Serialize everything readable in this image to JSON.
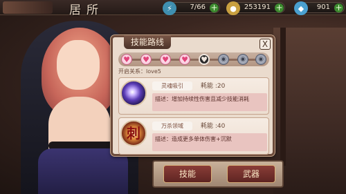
{
  "header": {
    "title": "居所",
    "resources": [
      {
        "icon": "lightning-icon",
        "value": "7/66",
        "color": "#3f8fb0"
      },
      {
        "icon": "coin-icon",
        "value": "253191",
        "color": "#c9a040"
      },
      {
        "icon": "gem-icon",
        "value": "901",
        "color": "#4aa0d0"
      }
    ]
  },
  "panel": {
    "title": "技能路线",
    "close_label": "X",
    "track": {
      "nodes": [
        {
          "state": "unlocked",
          "glyph": "♥"
        },
        {
          "state": "unlocked",
          "glyph": "♥"
        },
        {
          "state": "unlocked",
          "glyph": "♥"
        },
        {
          "state": "unlocked",
          "glyph": "♥"
        },
        {
          "state": "current",
          "glyph": "♥"
        },
        {
          "state": "locked",
          "glyph": "◉"
        },
        {
          "state": "locked",
          "glyph": "◉"
        },
        {
          "state": "locked",
          "glyph": "◉"
        }
      ]
    },
    "relation_label": "开启关系：love5",
    "skills": [
      {
        "name": "灵魂吸引",
        "cost": "耗能 :20",
        "desc": "描述：增加持续性伤害且减少技能消耗",
        "icon": "purple-orb-icon"
      },
      {
        "name": "万杀领域",
        "cost": "耗能 :40",
        "desc": "描述：造成更多单体伤害+沉默",
        "icon": "red-seal-icon",
        "icon_glyph": "刺"
      }
    ]
  },
  "bottom": {
    "skill_button": "技能",
    "weapon_button": "武器"
  }
}
